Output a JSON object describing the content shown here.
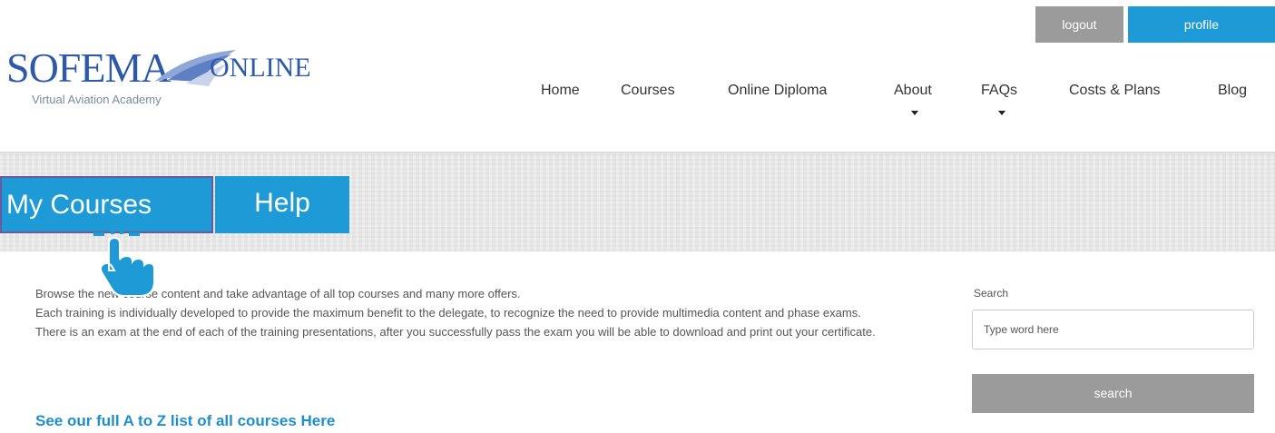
{
  "header": {
    "logout_label": "logout",
    "profile_label": "profile"
  },
  "logo": {
    "main": "SOFEMA",
    "online": "ONLINE",
    "tagline": "Virtual Aviation Academy"
  },
  "nav": {
    "items": [
      "Home",
      "Courses",
      "Online Diploma",
      "About",
      "FAQs",
      "Costs & Plans",
      "Blog"
    ]
  },
  "tabs": {
    "my_courses": "My Courses",
    "help": "Help"
  },
  "content": {
    "line1": "Browse the new course content and take advantage of all top courses and many more offers.",
    "line2": "Each training is individually developed to provide the maximum benefit to the delegate, to recognize the need to provide multimedia content and phase exams.",
    "line3": "There is an exam at the end of each of the training presentations, after you successfully pass the exam you will be able to download and print out your certificate.",
    "atoz_link": "See our full A to Z list of all courses Here"
  },
  "search": {
    "label": "Search",
    "placeholder": "Type word here",
    "button_label": "search"
  },
  "colors": {
    "accent": "#1e9ad6",
    "gray_button": "#9b9b9b",
    "logo_blue": "#2d59a8"
  }
}
